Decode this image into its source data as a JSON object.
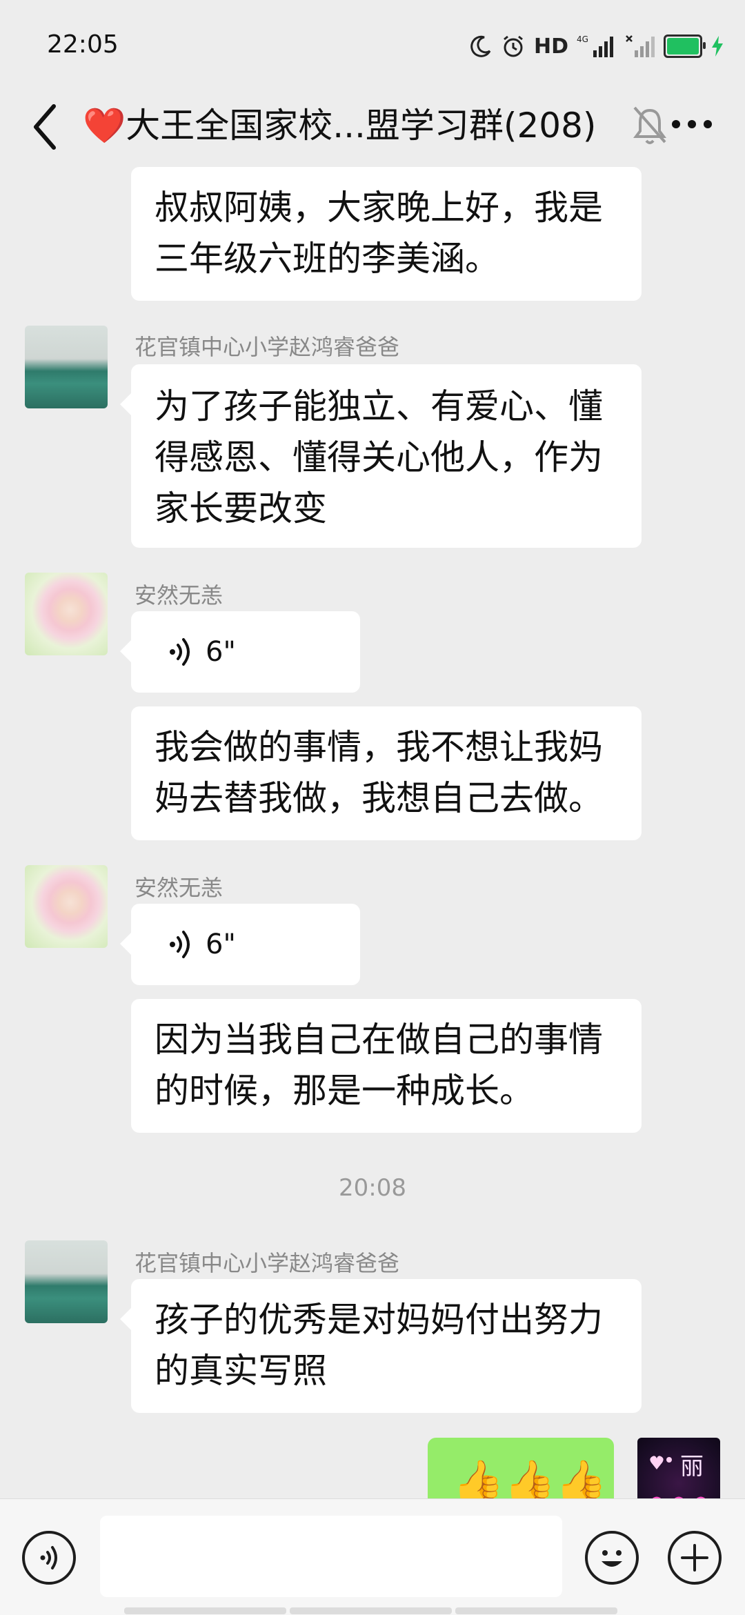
{
  "status_bar": {
    "time": "22:05",
    "network": "HD",
    "signal": "4G"
  },
  "header": {
    "title": "❤️大王全国家校...盟学习群(208)"
  },
  "messages": [
    {
      "text": "叔叔阿姨，大家晚上好，我是三年级六班的李美涵。"
    },
    {
      "sender": "花官镇中心小学赵鸿睿爸爸",
      "text": "为了孩子能独立、有爱心、懂得感恩、懂得关心他人，作为家长要改变"
    },
    {
      "sender": "安然无恙",
      "voice": "6\""
    },
    {
      "text": "我会做的事情，我不想让我妈妈去替我做，我想自己去做。"
    },
    {
      "sender": "安然无恙",
      "voice": "6\""
    },
    {
      "text": "因为当我自己在做自己的事情的时候，那是一种成长。"
    },
    {
      "sender": "花官镇中心小学赵鸿睿爸爸",
      "text": "孩子的优秀是对妈妈付出努力的真实写照"
    },
    {
      "mine": true,
      "text": "👍👍👍",
      "avatar_text": "丽"
    }
  ],
  "timestamp": "20:08"
}
